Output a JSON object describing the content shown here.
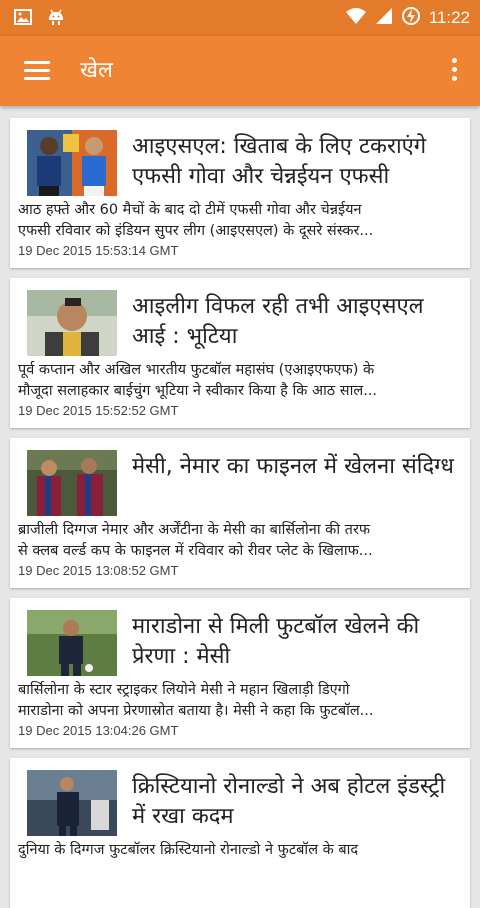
{
  "status_bar": {
    "time": "11:22"
  },
  "app_bar": {
    "title": "खेल"
  },
  "articles": [
    {
      "title": "आइएसएल: खिताब के लिए टकराएंगे एफसी गोवा और चेन्नईयन एफसी",
      "summary_line1": "आठ हफ्ते और 60 मैचों के बाद दो टीमें एफसी गोवा और चेन्नईयन",
      "summary_line2": "एफसी रविवार को इंडियन सुपर लीग (आइएसएल) के दूसरे संस्कर...",
      "date": "19 Dec 2015 15:53:14 GMT"
    },
    {
      "title": "आइलीग विफल रही तभी आइएसएल आई : भूटिया",
      "summary_line1": "पूर्व कप्तान और अखिल भारतीय फुटबॉल महासंघ (एआइएफएफ) के",
      "summary_line2": "मौजूदा सलाहकार बाईचुंग भूटिया ने स्वीकार किया है कि आठ साल...",
      "date": "19 Dec 2015 15:52:52 GMT"
    },
    {
      "title": "मेसी, नेमार का फाइनल में खेलना संदिग्ध",
      "summary_line1": "ब्राजीली दिग्गज नेमार और अर्जेंटीना के मेसी का बार्सिलोना की तरफ",
      "summary_line2": "से क्लब वर्ल्ड कप के फाइनल में रविवार को रीवर प्लेट के खिलाफ...",
      "date": "19 Dec 2015 13:08:52 GMT"
    },
    {
      "title": "माराडोना से मिली फुटबॉल खेलने की प्रेरणा : मेसी",
      "summary_line1": "बार्सिलोना के स्टार स्ट्राइकर लियोने मेसी ने महान खिलाड़ी डिएगो",
      "summary_line2": "माराडोना को अपना प्रेरणास्रोत बताया है। मेसी ने कहा कि फुटबॉल...",
      "date": "19 Dec 2015 13:04:26 GMT"
    },
    {
      "title": "क्रिस्टियानो रोनाल्डो ने अब होटल इंडस्ट्री में रखा कदम",
      "summary_line1": "दुनिया के दिग्गज फुटबॉलर क्रिस्टियानो रोनाल्डो ने फुटबॉल के बाद",
      "summary_line2": "",
      "date": ""
    }
  ]
}
